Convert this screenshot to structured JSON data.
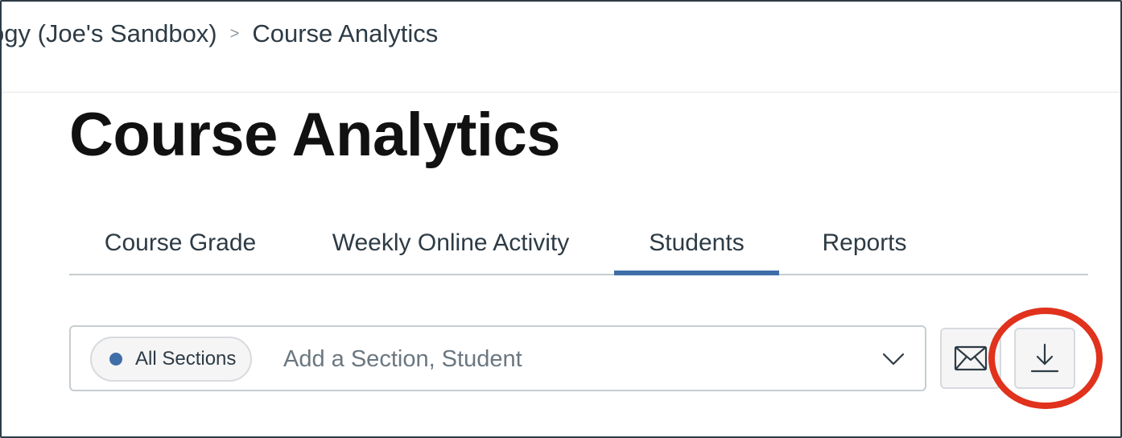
{
  "breadcrumb": {
    "items": [
      "ogy (Joe's Sandbox)",
      "Course Analytics"
    ],
    "separator": ">"
  },
  "page": {
    "title": "Course Analytics"
  },
  "tabs": [
    {
      "label": "Course Grade",
      "selected": false
    },
    {
      "label": "Weekly Online Activity",
      "selected": false
    },
    {
      "label": "Students",
      "selected": true
    },
    {
      "label": "Reports",
      "selected": false
    }
  ],
  "filter": {
    "chip_label": "All Sections",
    "placeholder": "Add a Section, Student",
    "value": ""
  },
  "actions": {
    "message_icon": "envelope-icon",
    "download_icon": "download-icon"
  },
  "colors": {
    "accent": "#3f6ea8",
    "annotation": "#e0321c",
    "text": "#2d3b45"
  }
}
